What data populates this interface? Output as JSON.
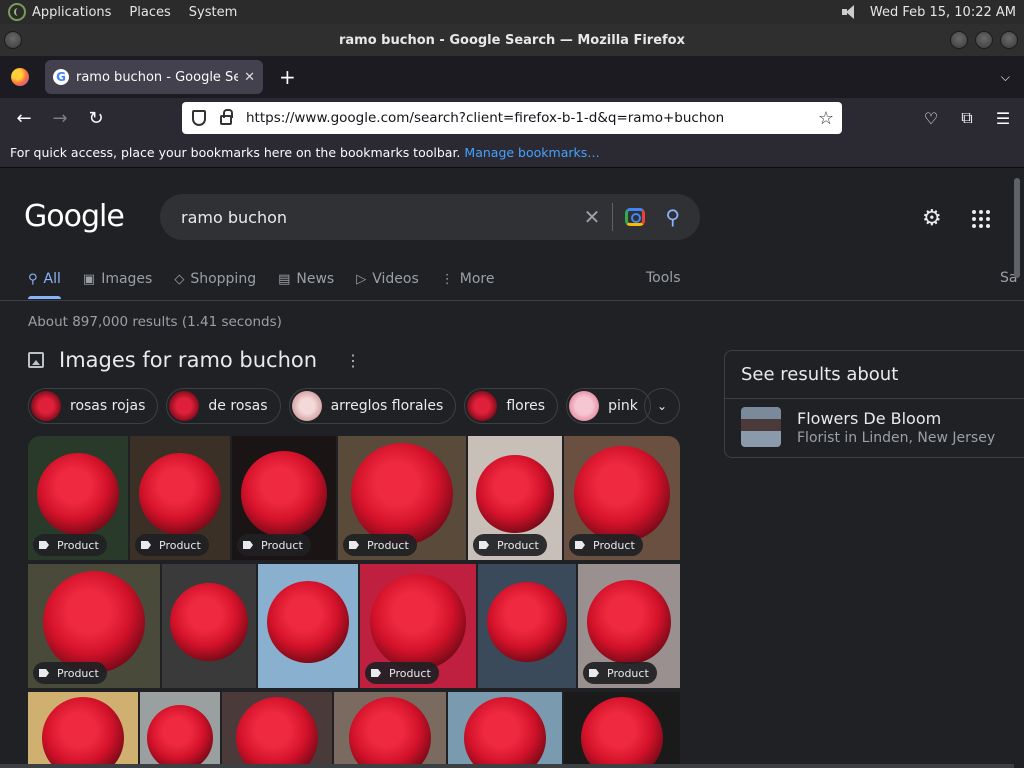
{
  "os_panel": {
    "menus": [
      "Applications",
      "Places",
      "System"
    ],
    "clock": "Wed Feb 15, 10:22 AM"
  },
  "window": {
    "title": "ramo buchon - Google Search — Mozilla Firefox"
  },
  "browser": {
    "tab_title": "ramo buchon - Google Search",
    "new_tab_label": "+",
    "url": "https://www.google.com/search?client=firefox-b-1-d&q=ramo+buchon",
    "bookmarks_message": "For quick access, place your bookmarks here on the bookmarks toolbar.",
    "bookmarks_link": "Manage bookmarks…"
  },
  "google": {
    "logo": "Google",
    "query": "ramo buchon",
    "tabs": [
      {
        "label": "All",
        "icon": "search-icon"
      },
      {
        "label": "Images",
        "icon": "image-icon"
      },
      {
        "label": "Shopping",
        "icon": "tag-icon"
      },
      {
        "label": "News",
        "icon": "news-icon"
      },
      {
        "label": "Videos",
        "icon": "video-icon"
      },
      {
        "label": "More",
        "icon": "more-vert-icon"
      }
    ],
    "tools_label": "Tools",
    "safesearch_label": "Sa",
    "result_stats": "About 897,000 results (1.41 seconds)",
    "images_heading": "Images for ramo buchon",
    "chips": [
      "rosas rojas",
      "de rosas",
      "arreglos florales",
      "flores",
      "pink"
    ],
    "badge_label": "Product",
    "knowledge": {
      "heading": "See results about",
      "entity_name": "Flowers De Bloom",
      "entity_type": "Florist in Linden, New Jersey"
    }
  },
  "colors": {
    "page_bg": "#202124",
    "link_blue": "#8ab4f8",
    "firefox_link": "#45a1ff",
    "rose_red": "#d3122a"
  }
}
